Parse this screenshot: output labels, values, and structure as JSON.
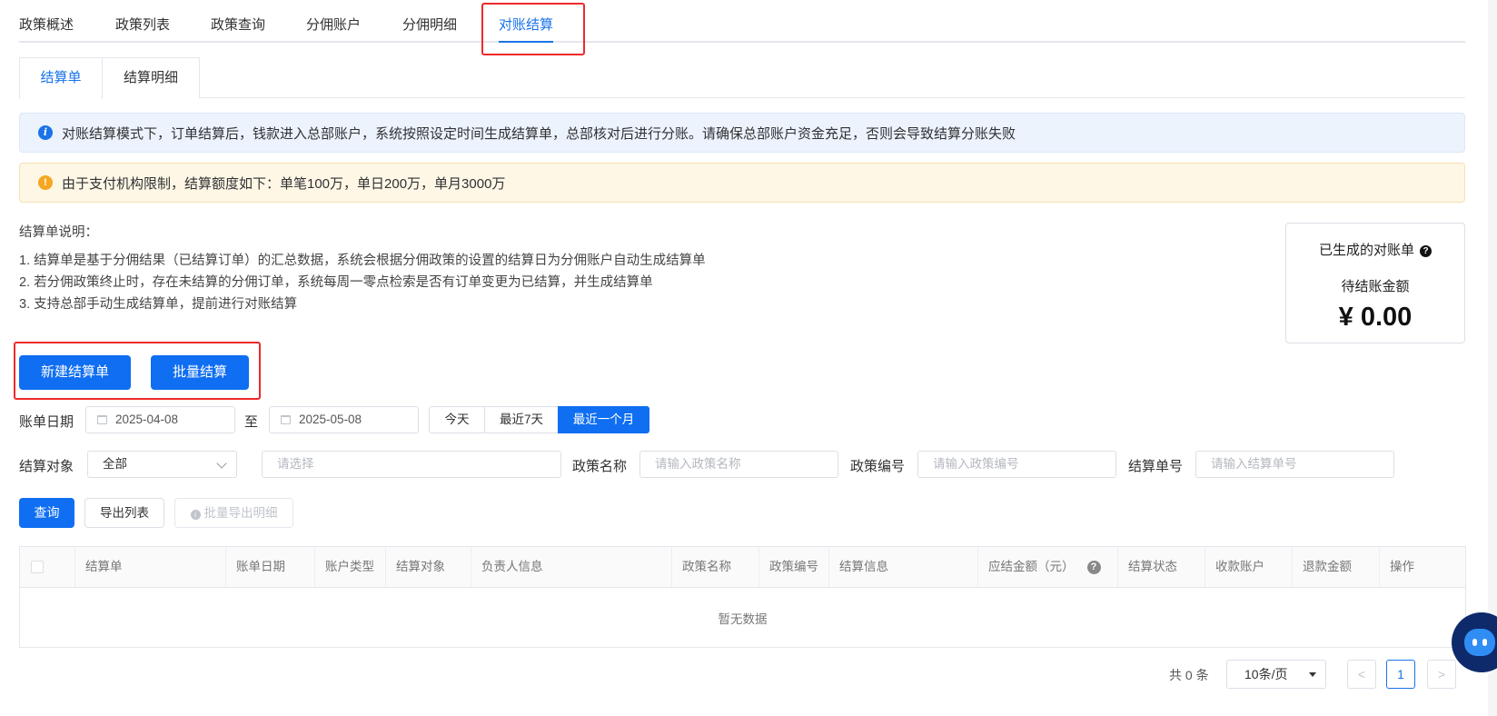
{
  "top_tabs": [
    "政策概述",
    "政策列表",
    "政策查询",
    "分佣账户",
    "分佣明细",
    "对账结算"
  ],
  "sub_tabs": [
    "结算单",
    "结算明细"
  ],
  "alerts": {
    "info": "对账结算模式下，订单结算后，钱款进入总部账户，系统按照设定时间生成结算单，总部核对后进行分账。请确保总部账户资金充足，否则会导致结算分账失败",
    "warning": "由于支付机构限制，结算额度如下：单笔100万，单日200万，单月3000万"
  },
  "description": {
    "title": "结算单说明：",
    "lines": [
      "1. 结算单是基于分佣结果（已结算订单）的汇总数据，系统会根据分佣政策的设置的结算日为分佣账户自动生成结算单",
      "2. 若分佣政策终止时，存在未结算的分佣订单，系统每周一零点检索是否有订单变更为已结算，并生成结算单",
      "3. 支持总部手动生成结算单，提前进行对账结算"
    ]
  },
  "summary_card": {
    "title": "已生成的对账单",
    "help_icon": "question-circle-icon",
    "label": "待结账金额",
    "amount": "¥ 0.00"
  },
  "actions": {
    "create": "新建结算单",
    "batch_settle": "批量结算"
  },
  "date_filter": {
    "label": "账单日期",
    "start": "2025-04-08",
    "separator": "至",
    "end": "2025-05-08",
    "presets": [
      "今天",
      "最近7天",
      "最近一个月"
    ],
    "active_preset": "最近一个月"
  },
  "filters": {
    "target_label": "结算对象",
    "target_value": "全部",
    "target_detail_placeholder": "请选择",
    "policy_name_label": "政策名称",
    "policy_name_placeholder": "请输入政策名称",
    "policy_no_label": "政策编号",
    "policy_no_placeholder": "请输入政策编号",
    "statement_no_label": "结算单号",
    "statement_no_placeholder": "请输入结算单号"
  },
  "query_buttons": {
    "query": "查询",
    "export": "导出列表",
    "batch_export": "批量导出明细"
  },
  "table": {
    "columns": [
      "结算单",
      "账单日期",
      "账户类型",
      "结算对象",
      "负责人信息",
      "政策名称",
      "政策编号",
      "结算信息",
      "应结金额（元）",
      "结算状态",
      "收款账户",
      "退款金额",
      "操作"
    ],
    "empty_text": "暂无数据"
  },
  "pagination": {
    "total": "共 0 条",
    "page_size": "10条/页",
    "current_page": "1",
    "prev": "<",
    "next": ">"
  },
  "colors": {
    "primary": "#0f6ef2",
    "highlight_box": "#ee2a2a",
    "info_bg": "#ecf3fd",
    "warning_bg": "#fff7e6"
  }
}
